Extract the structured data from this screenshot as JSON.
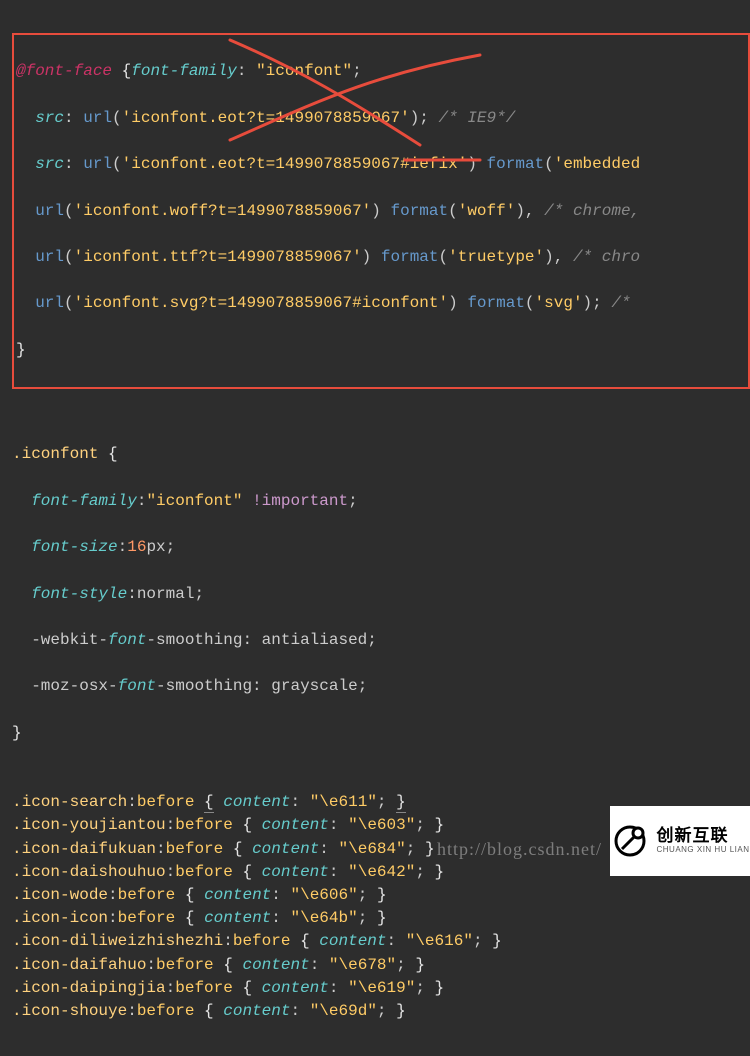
{
  "fontface": {
    "at": "@font-face",
    "ff_prop": "font-family",
    "ff_val": "\"iconfont\"",
    "src": "src",
    "url_fn": "url",
    "fmt_fn": "format",
    "eot": "'iconfont.eot?t=1499078859067'",
    "eot_c": "/* IE9*/",
    "eot_fix": "'iconfont.eot?t=1499078859067#iefix'",
    "fmt_eo": "'embedded",
    "woff": "'iconfont.woff?t=1499078859067'",
    "fmt_woff": "'woff'",
    "woff_c": "/* chrome,",
    "ttf": "'iconfont.ttf?t=1499078859067'",
    "fmt_ttf": "'truetype'",
    "ttf_c": "/* chro",
    "svg": "'iconfont.svg?t=1499078859067#iconfont'",
    "fmt_svg": "'svg'",
    "svg_c": "/*"
  },
  "iconfont_rule": {
    "sel": ".iconfont",
    "ff_prop": "font-family",
    "ff_val": "\"iconfont\"",
    "imp": "!important",
    "fs_prop": "font-size",
    "fs_num": "16",
    "fs_unit": "px",
    "fstyle_prop": "font-style",
    "fstyle_val": "normal",
    "wk_pre": "-webkit-",
    "wk_mid": "font",
    "wk_suf": "-smoothing",
    "wk_val": "antialiased",
    "moz_pre": "-moz-osx-",
    "moz_mid": "font",
    "moz_suf": "-smoothing",
    "moz_val": "grayscale"
  },
  "icons": [
    {
      "sel": ".icon-search:before",
      "val": "\"\\e611\"",
      "underline_brace": true
    },
    {
      "sel": ".icon-youjiantou:before",
      "val": "\"\\e603\""
    },
    {
      "sel": ".icon-daifukuan:before",
      "val": "\"\\e684\""
    },
    {
      "sel": ".icon-daishouhuo:before",
      "val": "\"\\e642\""
    },
    {
      "sel": ".icon-wode:before",
      "val": "\"\\e606\""
    },
    {
      "sel": ".icon-icon:before",
      "val": "\"\\e64b\""
    },
    {
      "sel": ".icon-diliweizhishezhi:before",
      "val": "\"\\e616\""
    },
    {
      "sel": ".icon-daifahuo:before",
      "val": "\"\\e678\""
    },
    {
      "sel": ".icon-daipingjia:before",
      "val": "\"\\e619\""
    },
    {
      "sel": ".icon-shouye:before",
      "val": "\"\\e69d\""
    }
  ],
  "content_prop": "content",
  "watermark": "http://blog.csdn.net/",
  "logo": {
    "cn": "创新互联",
    "en": "CHUANG XIN HU LIAN"
  }
}
